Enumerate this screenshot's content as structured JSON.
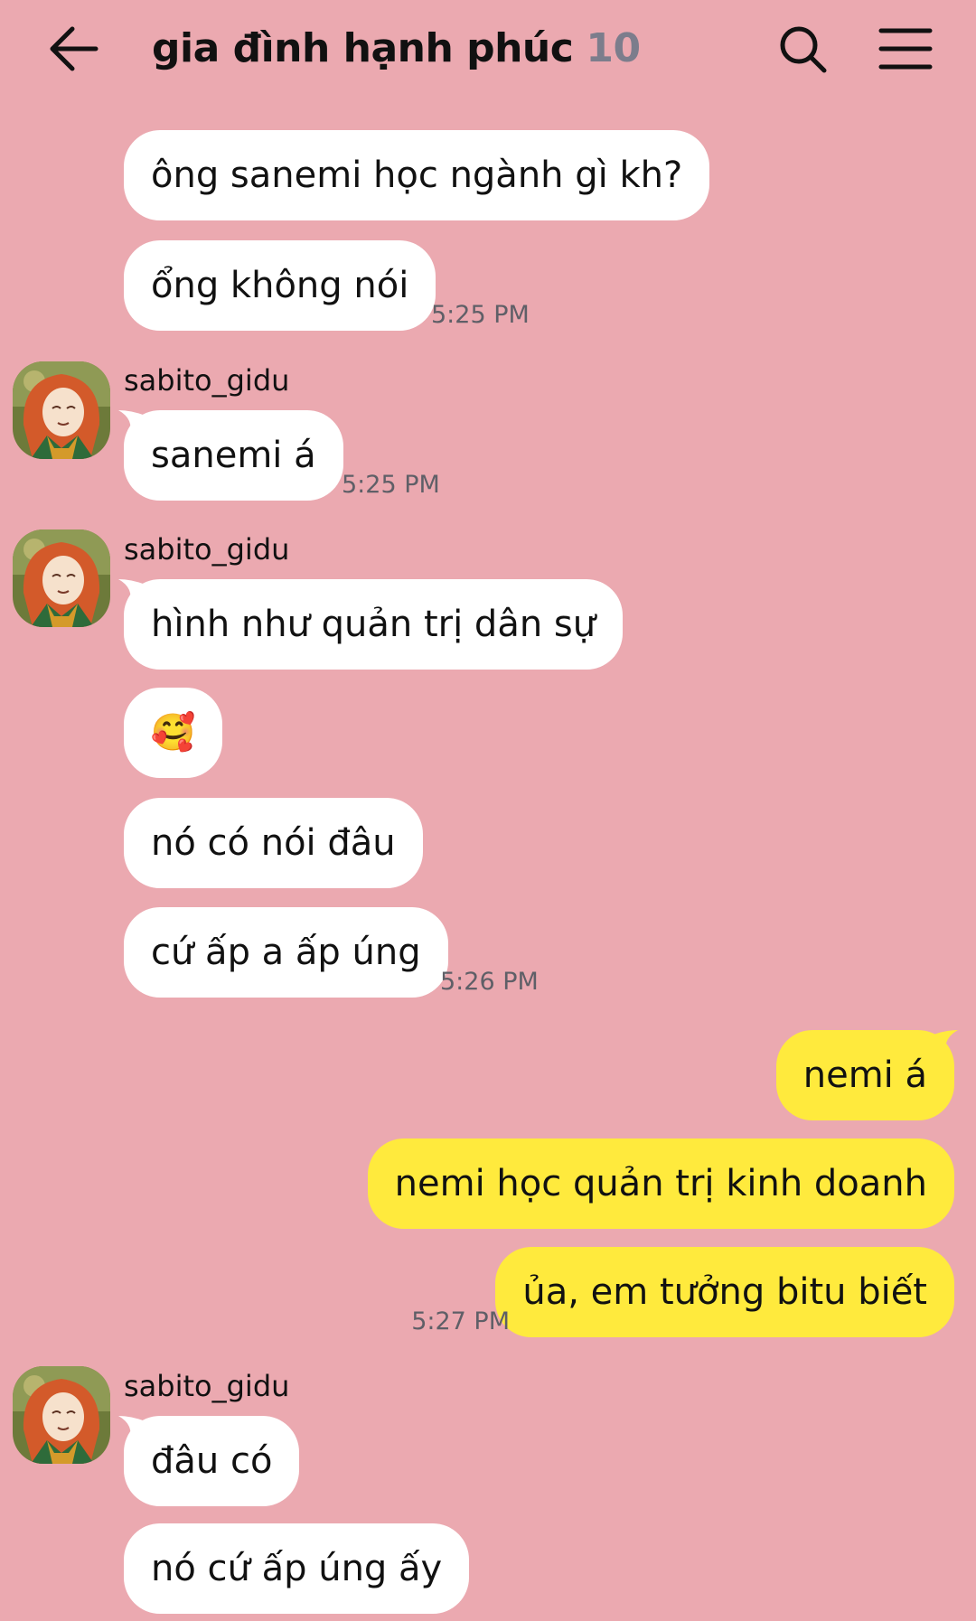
{
  "header": {
    "title": "gia đình hạnh phúc",
    "member_count": "10",
    "back_icon": "arrow-left-icon",
    "search_icon": "search-icon",
    "menu_icon": "hamburger-menu-icon"
  },
  "colors": {
    "background": "#eba9b0",
    "incoming_bubble": "#ffffff",
    "outgoing_bubble": "#ffea3d",
    "count": "#7c7d8c",
    "timestamp": "#5f5f67"
  },
  "messages": [
    {
      "text": "ông sanemi học ngành gì kh?"
    },
    {
      "text": "ổng không nói",
      "time": "5:25 PM"
    },
    {
      "sender": "sabito_gidu",
      "text": "sanemi á",
      "time": "5:25 PM"
    },
    {
      "sender": "sabito_gidu",
      "text": "hình như quản trị dân sự"
    },
    {
      "text": "🥰"
    },
    {
      "text": "nó có nói đâu"
    },
    {
      "text": "cứ ấp a ấp úng",
      "time": "5:26 PM"
    },
    {
      "text": "nemi á"
    },
    {
      "text": "nemi học quản trị kinh doanh"
    },
    {
      "text": "ủa, em tưởng bitu biết",
      "time": "5:27 PM"
    },
    {
      "sender": "sabito_gidu",
      "text": "đâu có"
    },
    {
      "text": "nó cứ ấp úng ấy"
    }
  ]
}
